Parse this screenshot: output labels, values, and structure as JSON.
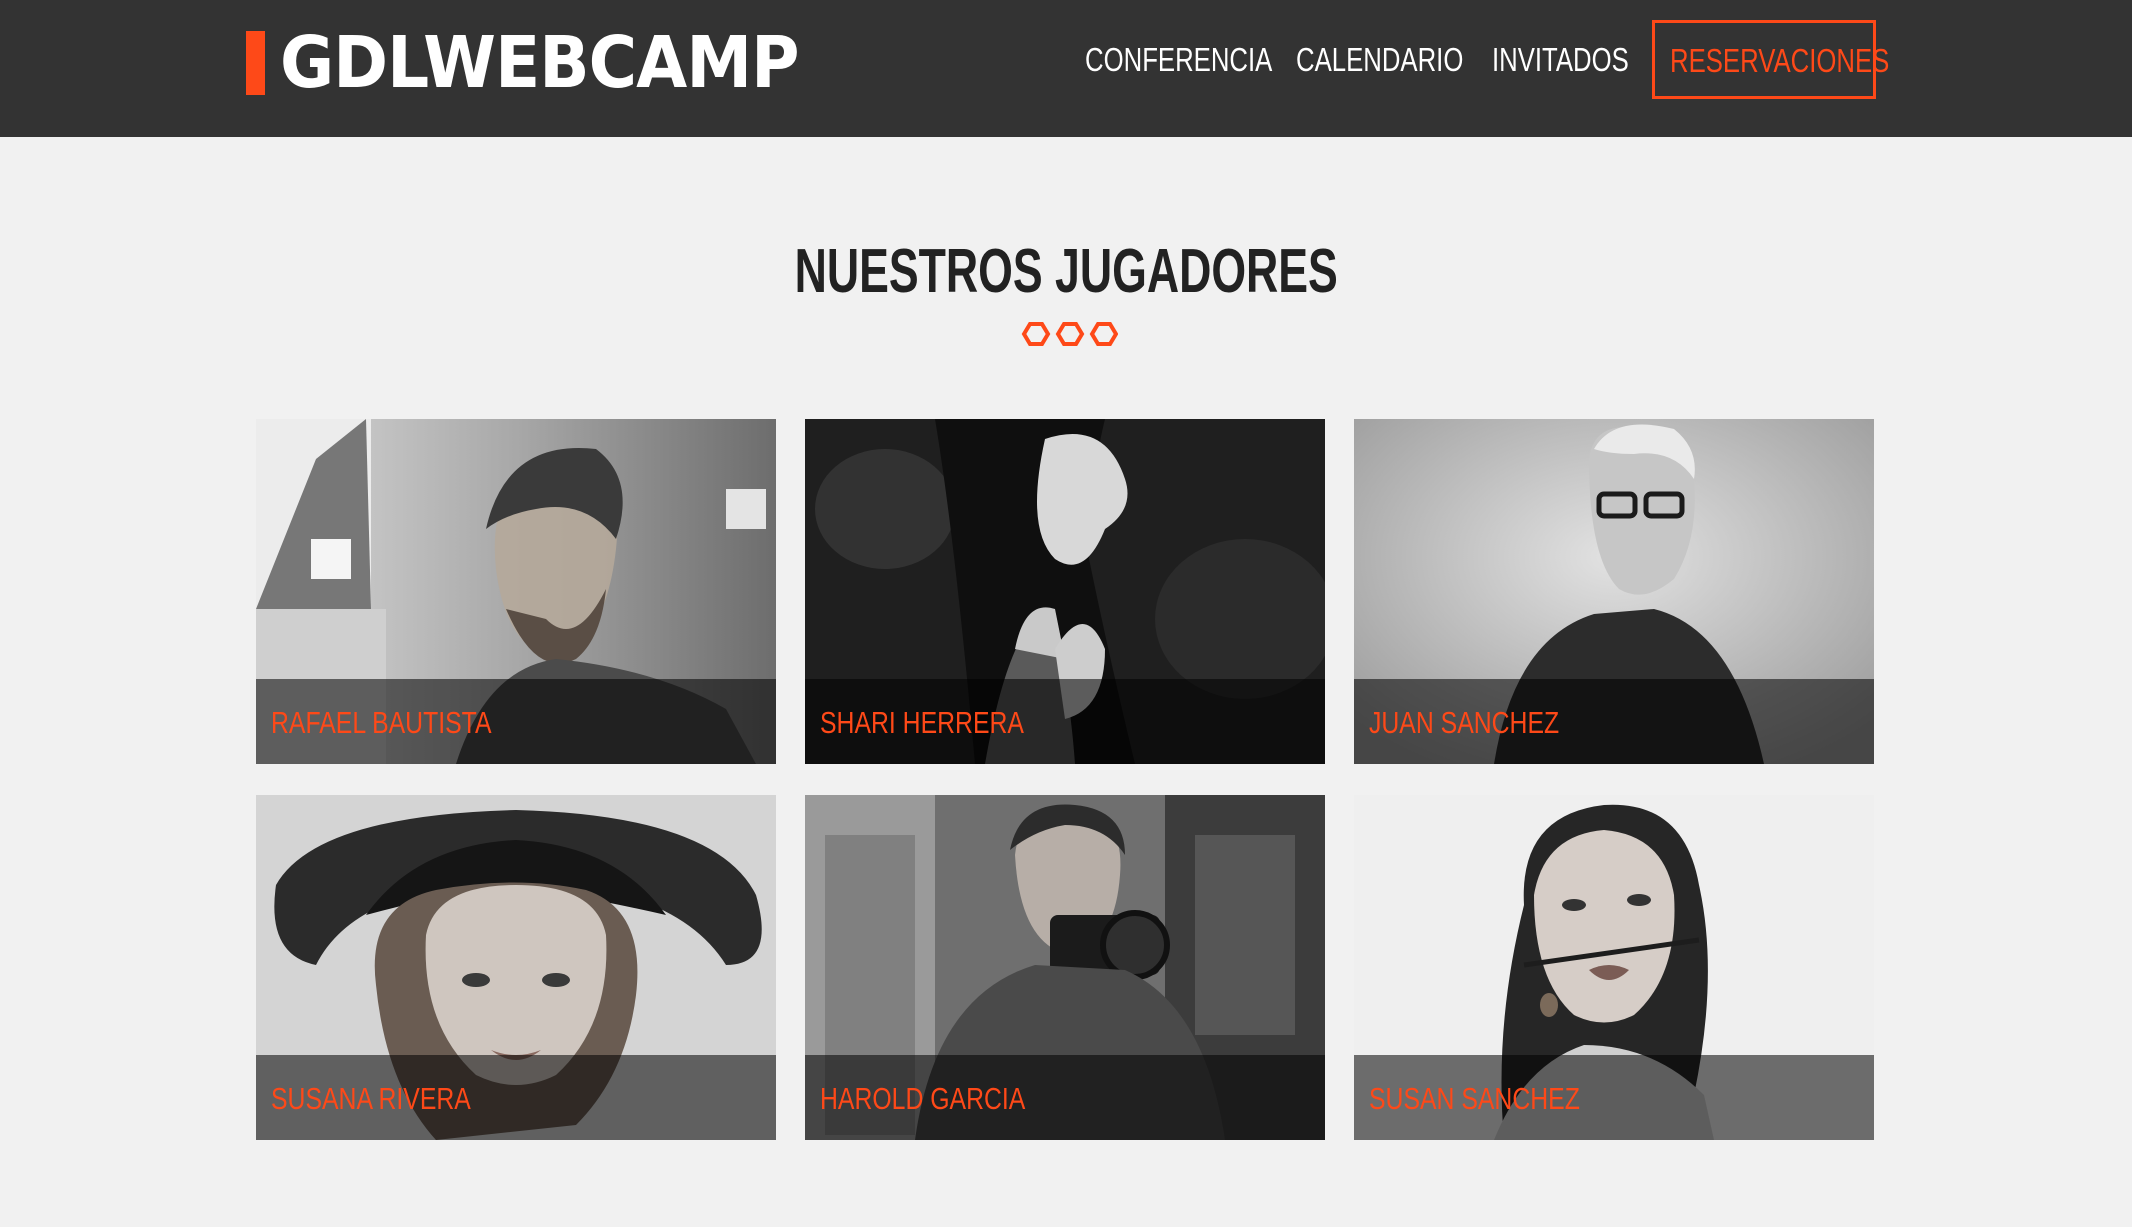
{
  "header": {
    "logo": "GDLWEBCAMP",
    "nav": [
      {
        "label": "CONFERENCIA"
      },
      {
        "label": "CALENDARIO"
      },
      {
        "label": "INVITADOS"
      }
    ],
    "cta_label": "RESERVACIONES"
  },
  "section": {
    "title": "NUESTROS JUGADORES",
    "decoration_icons": [
      "hexagon-icon",
      "hexagon-icon",
      "hexagon-icon"
    ]
  },
  "speakers": [
    {
      "name": "RAFAEL BAUTISTA"
    },
    {
      "name": "SHARI HERRERA"
    },
    {
      "name": "JUAN SANCHEZ"
    },
    {
      "name": "SUSANA RIVERA"
    },
    {
      "name": "HAROLD GARCIA"
    },
    {
      "name": "SUSAN SANCHEZ"
    }
  ],
  "colors": {
    "accent": "#fe4918",
    "header_bg": "#333333",
    "page_bg": "#f1f1f1",
    "title_text": "#222222"
  }
}
